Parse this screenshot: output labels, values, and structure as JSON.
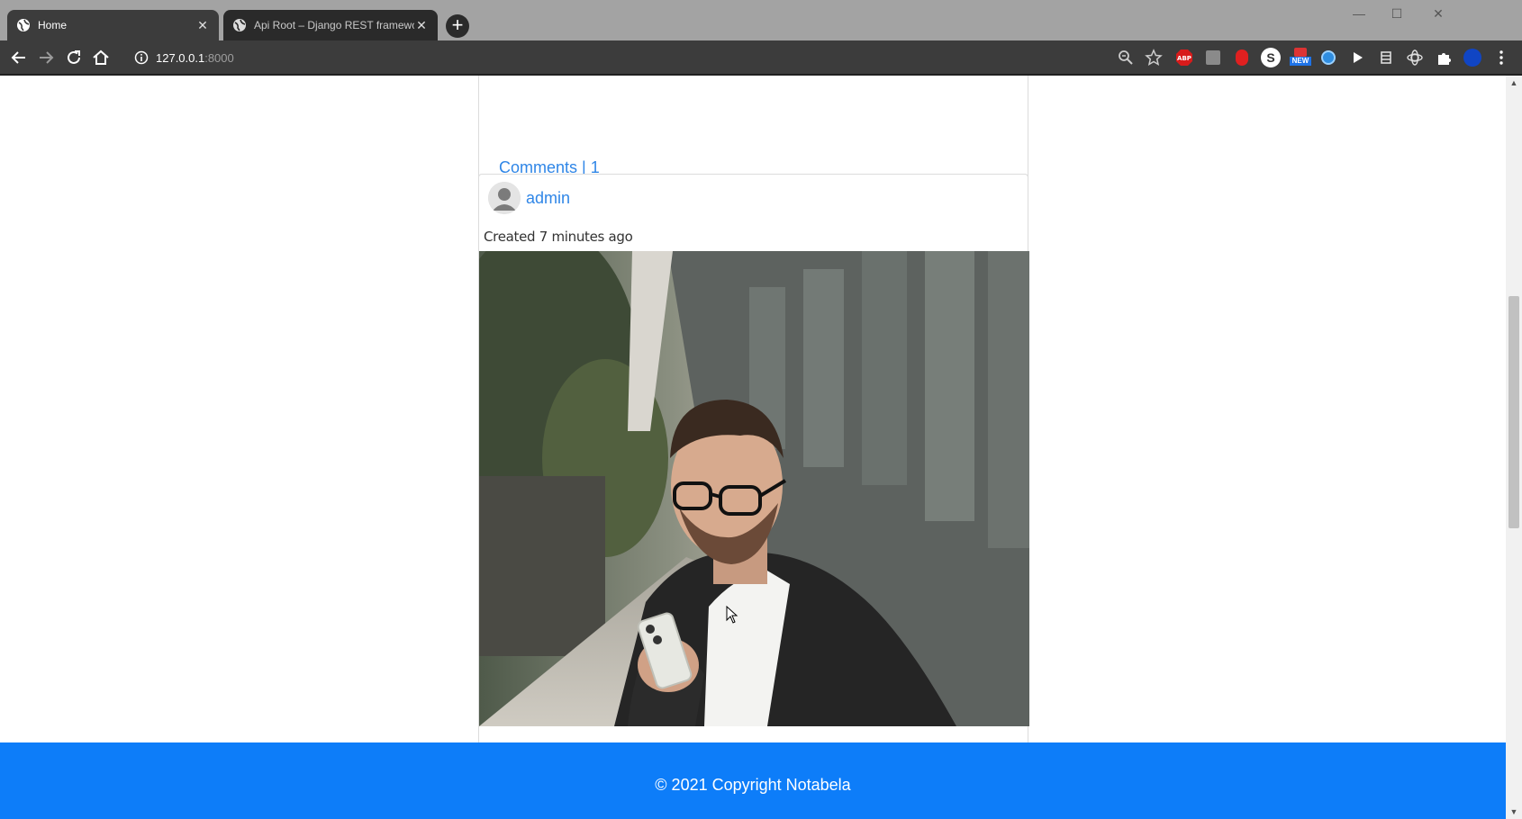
{
  "browser": {
    "tabs": [
      {
        "title": "Home",
        "active": true
      },
      {
        "title": "Api Root – Django REST framewo",
        "active": false
      }
    ],
    "new_tab_label": "+",
    "address": {
      "host": "127.0.0.1",
      "port": ":8000"
    },
    "window_controls": {
      "minimize": "—",
      "maximize": "☐",
      "close": "✕"
    },
    "extensions": [
      "zoom-icon",
      "star-icon",
      "abp-icon",
      "k-icon",
      "hand-icon",
      "s-icon",
      "new-badge-icon",
      "cloud-icon",
      "play-icon",
      "bookmark-icon",
      "gear-icon",
      "puzzle-icon",
      "profile-icon",
      "menu-icon"
    ],
    "abp_label": "ABP",
    "new_label": "NEW",
    "s_label": "S"
  },
  "page": {
    "previous_post": {
      "comments_label": "Comments | 1"
    },
    "post": {
      "author": "admin",
      "created": "Created 7 minutes ago",
      "image_alt": "man-with-phone-photo"
    },
    "footer": {
      "copyright": "© 2021 Copyright Notabela"
    }
  },
  "colors": {
    "link": "#2f86e7",
    "footer": "#0d7df9",
    "chrome": "#3c3c3c"
  }
}
